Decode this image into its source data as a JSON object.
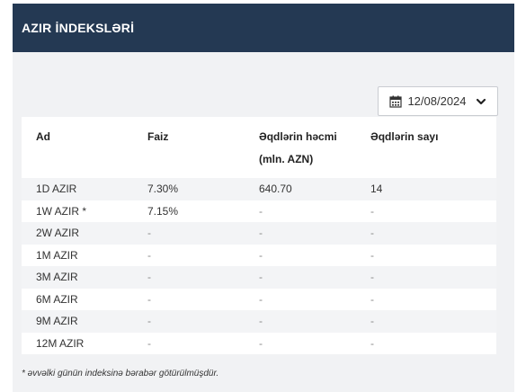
{
  "header": {
    "title": "AZIR İNDEKSLƏRİ"
  },
  "date_picker": {
    "value": "12/08/2024"
  },
  "table": {
    "columns": [
      "Ad",
      "Faiz",
      "Əqdlərin həcmi (mln. AZN)",
      "Əqdlərin sayı"
    ],
    "rows": [
      {
        "name": "1D AZIR",
        "rate": "7.30%",
        "volume": "640.70",
        "count": "14"
      },
      {
        "name": "1W AZIR *",
        "rate": "7.15%",
        "volume": "-",
        "count": "-"
      },
      {
        "name": "2W AZIR",
        "rate": "-",
        "volume": "-",
        "count": "-"
      },
      {
        "name": "1M AZIR",
        "rate": "-",
        "volume": "-",
        "count": "-"
      },
      {
        "name": "3M AZIR",
        "rate": "-",
        "volume": "-",
        "count": "-"
      },
      {
        "name": "6M AZIR",
        "rate": "-",
        "volume": "-",
        "count": "-"
      },
      {
        "name": "9M AZIR",
        "rate": "-",
        "volume": "-",
        "count": "-"
      },
      {
        "name": "12M AZIR",
        "rate": "-",
        "volume": "-",
        "count": "-"
      }
    ]
  },
  "footnote": "* əvvəlki günün indeksinə bərabər götürülmüşdür.",
  "colors": {
    "header_bg": "#243953",
    "panel_bg": "#f1f2f4"
  },
  "icons": {
    "date": "calendar-icon",
    "dropdown": "chevron-down-icon"
  }
}
